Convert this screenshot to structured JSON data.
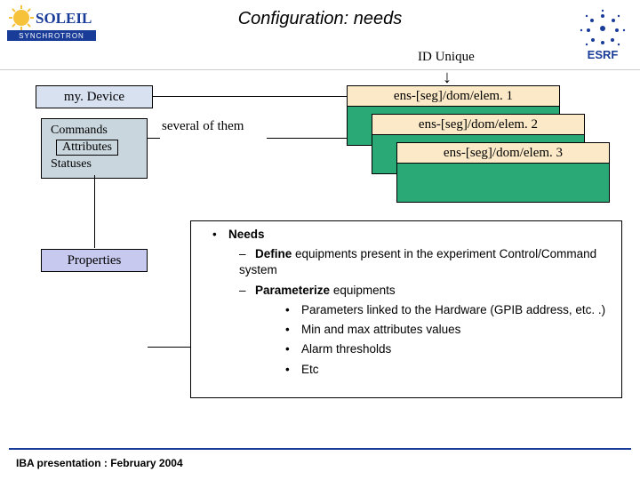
{
  "title": "Configuration: needs",
  "id_unique": "ID Unique",
  "mydevice": "my. Device",
  "commands": "Commands",
  "attributes": "Attributes",
  "statuses": "Statuses",
  "several": "several of them",
  "dev1": "ens-[seg]/dom/elem. 1",
  "dev2": "ens-[seg]/dom/elem. 2",
  "dev3": "ens-[seg]/dom/elem. 3",
  "properties": "Properties",
  "footer": "IBA presentation : February 2004",
  "needs": {
    "heading": "Needs",
    "items": [
      {
        "text_bold": "Define",
        "text_rest": " equipments present in the experiment Control/Command system"
      },
      {
        "text_bold": "Parameterize",
        "text_rest": " equipments",
        "sub": [
          "Parameters linked to the Hardware (GPIB address, etc. .)",
          "Min and max attributes values",
          "Alarm thresholds",
          "Etc"
        ]
      }
    ]
  },
  "colors": {
    "green": "#2aa876",
    "tan": "#fbe9c7",
    "lav": "#c7c9ee",
    "blue": "#1a3c99"
  }
}
